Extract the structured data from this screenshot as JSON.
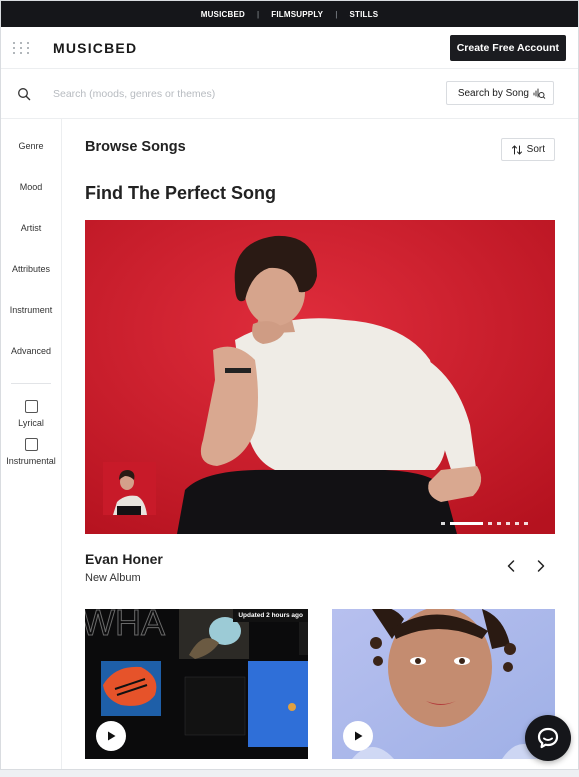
{
  "topbar": {
    "links": [
      "MUSICBED",
      "FILMSUPPLY",
      "STILLS"
    ],
    "separator": "|"
  },
  "header": {
    "logo": "MUSICBED",
    "cta_label": "Create Free Account"
  },
  "search": {
    "placeholder": "Search (moods, genres or themes)",
    "value": "",
    "song_search_label": "Search by Song"
  },
  "sidebar": {
    "items": [
      "Genre",
      "Mood",
      "Artist",
      "Attributes",
      "Instrument",
      "Advanced"
    ],
    "checkboxes": [
      {
        "label": "Lyrical",
        "checked": false
      },
      {
        "label": "Instrumental",
        "checked": false
      }
    ]
  },
  "main": {
    "browse_title": "Browse Songs",
    "sort_label": "Sort",
    "find_title": "Find The Perfect Song",
    "featured": {
      "artist": "Evan Honer",
      "subtitle": "New Album",
      "slide_count": 7,
      "active_slide": 1
    },
    "cards": [
      {
        "badge": "Updated 2 hours ago",
        "art_text": "WHA"
      },
      {
        "badge": ""
      }
    ]
  },
  "colors": {
    "topbar_bg": "#15161a",
    "hero_bg": "#cc1f2e",
    "cta_bg": "#1b1c20",
    "card_right_bg": "#a9b6e8"
  },
  "icons": [
    "grid-icon",
    "search-icon",
    "song-wave-icon",
    "sort-icon",
    "chevron-left-icon",
    "chevron-right-icon",
    "play-icon",
    "chat-icon"
  ]
}
